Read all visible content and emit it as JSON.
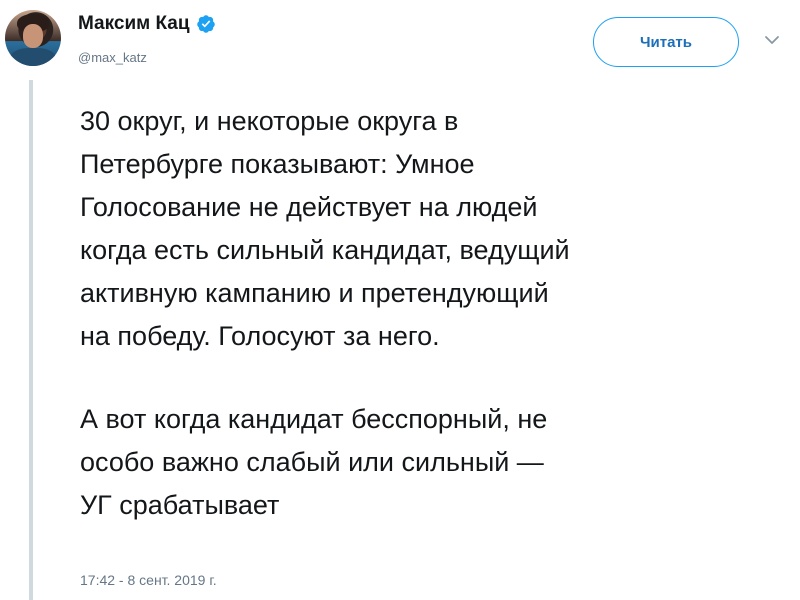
{
  "author": {
    "display_name": "Максим Кац",
    "handle": "@max_katz",
    "verified": true
  },
  "follow_button": {
    "label": "Читать"
  },
  "tweet": {
    "paragraphs": [
      "30 округ, и некоторые округа в\nПетербурге показывают: Умное\nГолосование не действует на людей\nкогда есть сильный кандидат, ведущий\nактивную кампанию и претендующий\nна победу. Голосуют за него.",
      "А вот когда кандидат бесспорный, не\nособо важно слабый или сильный —\nУГ срабатывает"
    ],
    "timestamp": "17:42 - 8 сент. 2019 г."
  },
  "icons": {
    "verified": "verified-badge-icon",
    "menu": "chevron-down-icon"
  },
  "colors": {
    "accent": "#1da1f2",
    "text": "#14171a",
    "muted": "#657786"
  }
}
